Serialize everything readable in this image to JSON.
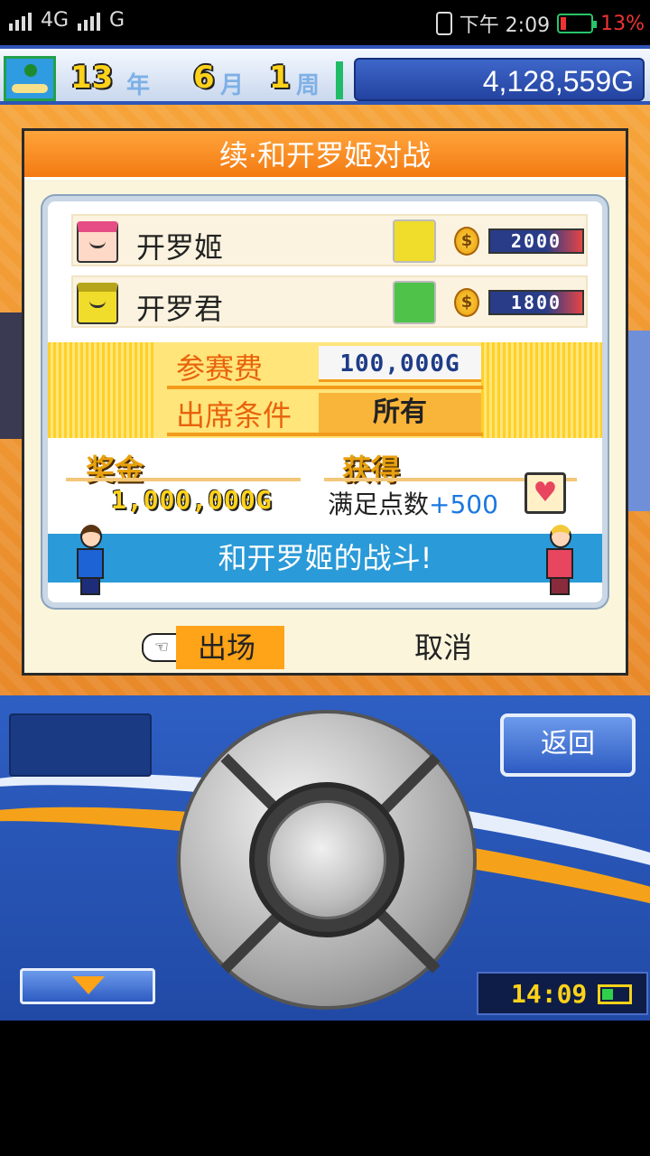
{
  "status_bar": {
    "network_1": "4G",
    "network_2": "G",
    "time": "下午 2:09",
    "battery": "13%"
  },
  "game_header": {
    "year_num": "13",
    "year_unit": "年",
    "month_num": "6",
    "month_unit": "月",
    "week_num": "1",
    "week_unit": "周",
    "money": "4,128,559G"
  },
  "dialog": {
    "title": "续·和开罗姬对战",
    "team_1": {
      "name": "开罗姬",
      "power": "2000",
      "coin": "$"
    },
    "team_2": {
      "name": "开罗君",
      "power": "1800",
      "coin": "$"
    },
    "fee_label": "参赛费",
    "fee_value": "100,000G",
    "condition_label": "出席条件",
    "condition_value": "所有",
    "prize_label": "奖金",
    "prize_value": "1,000,000G",
    "reward_label": "获得",
    "reward_text": "满足点数",
    "reward_plus": "+500",
    "banner": "和开罗姬的战斗!",
    "confirm_label": "出场",
    "cancel_label": "取消"
  },
  "controls": {
    "back_label": "返回",
    "clock": "14:09"
  },
  "colors": {
    "title_orange": "#f37a12",
    "banner_blue": "#2a9ad8",
    "panel_blue": "#2e5fc3",
    "accent_yellow": "#ffd21a"
  }
}
